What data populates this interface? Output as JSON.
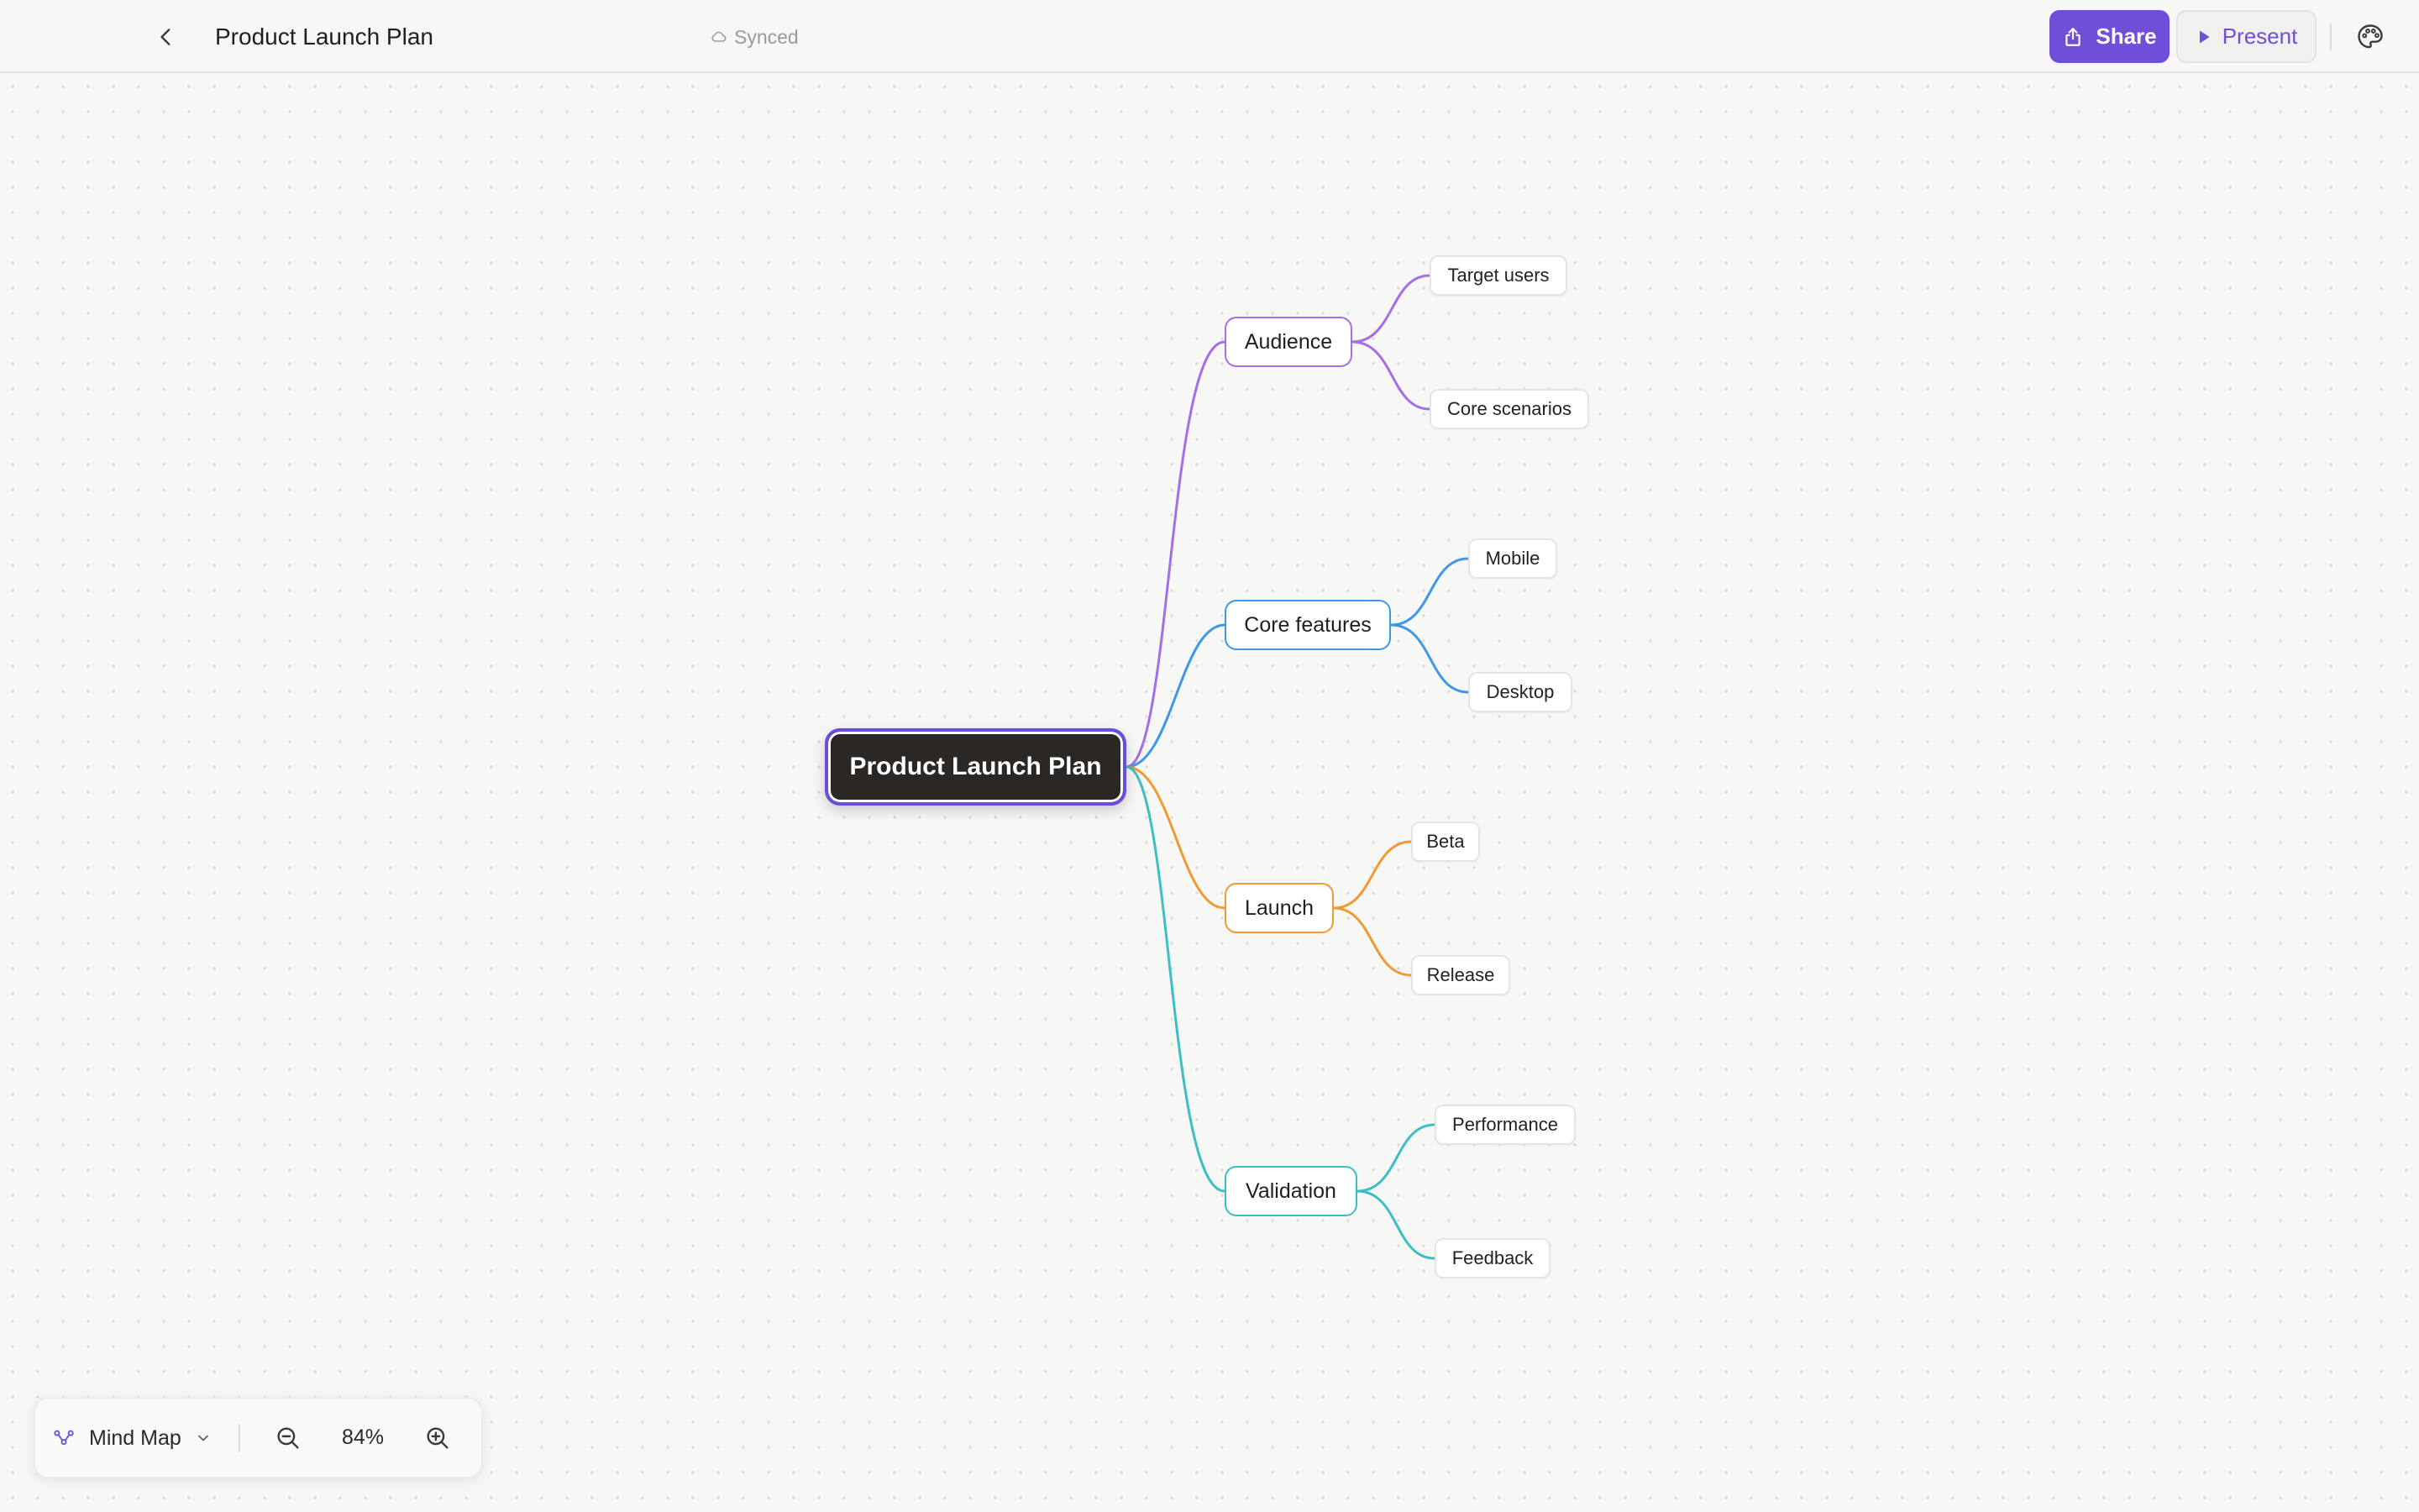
{
  "header": {
    "title": "Product Launch Plan",
    "sync_status": "Synced",
    "share_label": "Share",
    "present_label": "Present"
  },
  "colors": {
    "accent": "#6f4fd8",
    "root_fill": "#2b2725",
    "branch_audience": "#a46ee8",
    "branch_core_features": "#3f98e6",
    "branch_launch": "#ee9a35",
    "branch_validation": "#3cbfc4"
  },
  "mindmap": {
    "root": "Product Launch Plan",
    "branches": [
      {
        "label": "Audience",
        "children": [
          "Target users",
          "Core scenarios"
        ]
      },
      {
        "label": "Core features",
        "children": [
          "Mobile",
          "Desktop"
        ]
      },
      {
        "label": "Launch",
        "children": [
          "Beta",
          "Release"
        ]
      },
      {
        "label": "Validation",
        "children": [
          "Performance",
          "Feedback"
        ]
      }
    ]
  },
  "toolbar": {
    "mode_label": "Mind Map",
    "zoom_level": "84%"
  },
  "icons": {
    "back": "chevron-left-icon",
    "sync": "cloud-icon",
    "share": "share-icon",
    "present": "play-icon",
    "theme": "palette-icon",
    "mode": "mindmap-icon",
    "mode_dropdown": "chevron-down-icon",
    "zoom_out": "zoom-out-icon",
    "zoom_in": "zoom-in-icon"
  }
}
